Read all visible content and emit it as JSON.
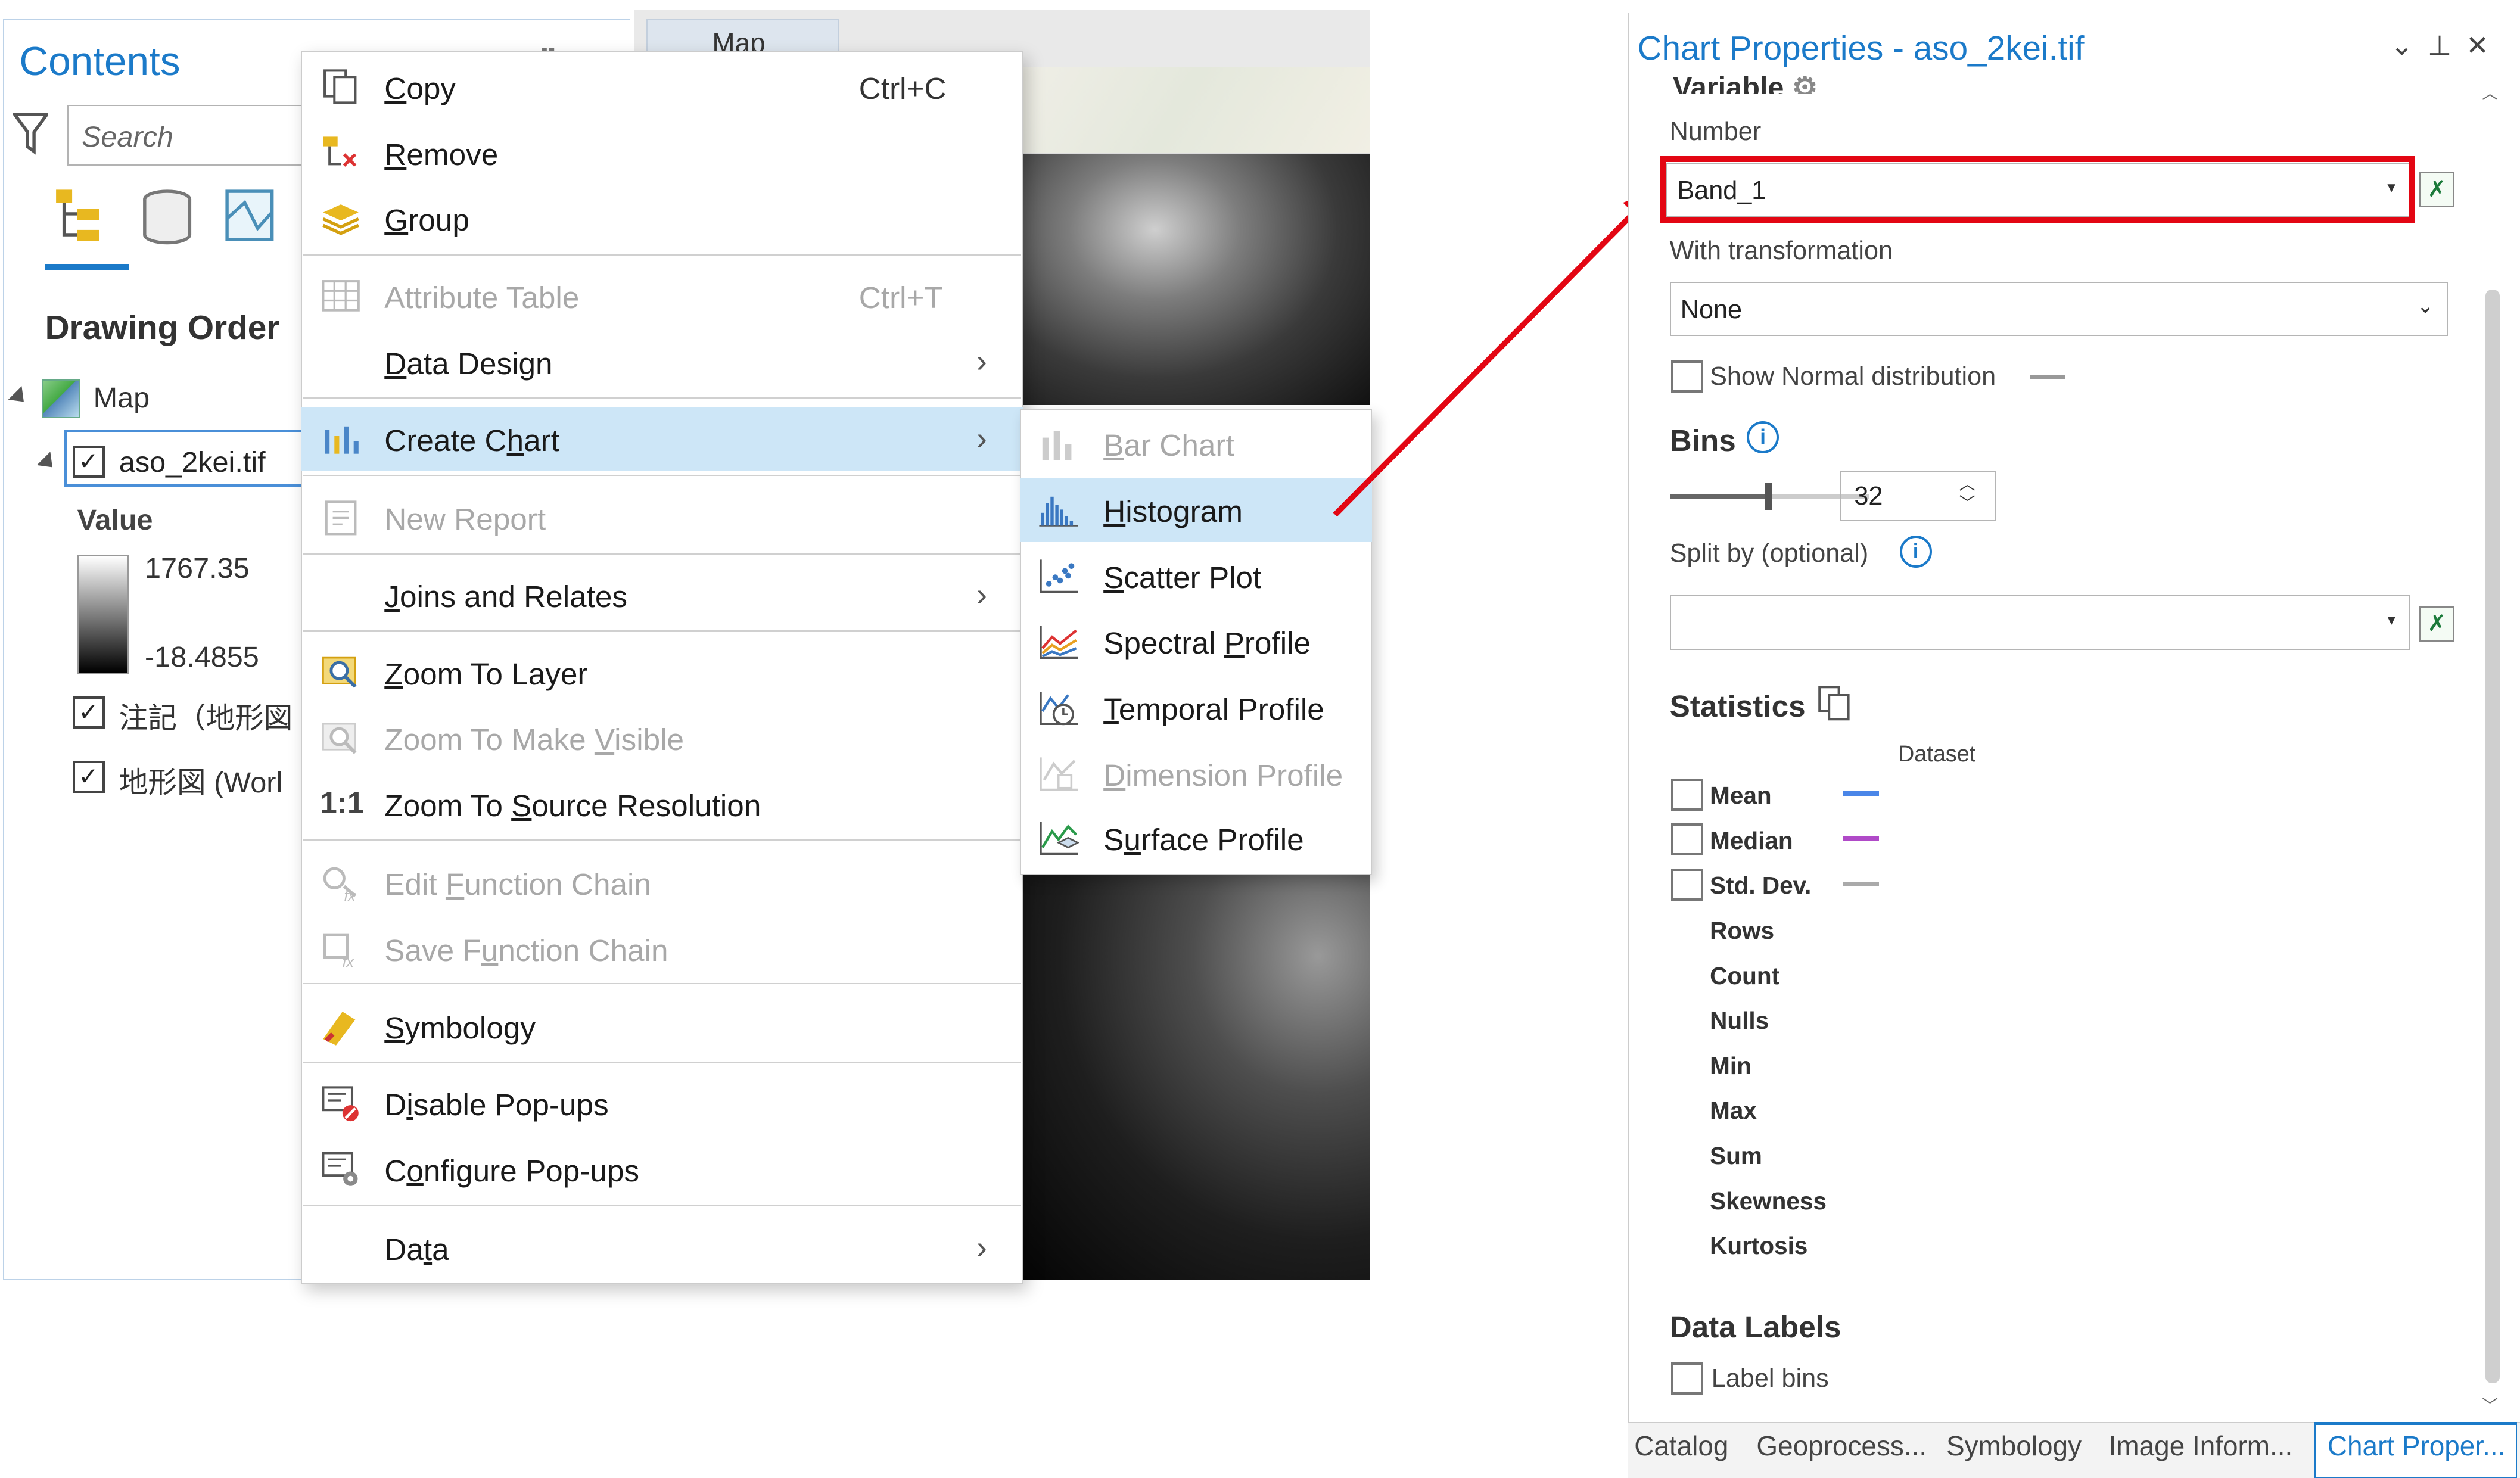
{
  "contents": {
    "title": "Contents",
    "search_placeholder": "Search",
    "drawing_order": "Drawing Order",
    "map_label": "Map",
    "layer_name": "aso_2kei.tif",
    "value_label": "Value",
    "legend_max": "1767.35",
    "legend_min": "-18.4855",
    "layer2_name": "注記（地形図",
    "layer3_name": "地形図 (Worl"
  },
  "map_tab": {
    "label": "Map"
  },
  "context_menu": {
    "copy": {
      "pre": "",
      "key": "C",
      "post": "opy",
      "shortcut": "Ctrl+C"
    },
    "remove": {
      "pre": "",
      "key": "R",
      "post": "emove"
    },
    "group": {
      "pre": "",
      "key": "G",
      "post": "roup"
    },
    "attribute_table": {
      "label": "Attribute Table",
      "shortcut": "Ctrl+T"
    },
    "data_design": {
      "pre": "",
      "key": "D",
      "post": "ata Design"
    },
    "create_chart": {
      "pre": "Create C",
      "key": "h",
      "post": "art"
    },
    "new_report": {
      "label": "New Report"
    },
    "joins": {
      "pre": "",
      "key": "J",
      "post": "oins and Relates"
    },
    "zoom_layer": {
      "pre": "",
      "key": "Z",
      "post": "oom To Layer"
    },
    "zoom_visible": {
      "pre": "Zoom To Make ",
      "key": "V",
      "post": "isible"
    },
    "zoom_source": {
      "pre": "Zoom To ",
      "key": "S",
      "post": "ource Resolution"
    },
    "edit_function": {
      "pre": "Edit ",
      "key": "F",
      "post": "unction Chain"
    },
    "save_function": {
      "pre": "Save F",
      "key": "u",
      "post": "nction Chain"
    },
    "symbology": {
      "pre": "",
      "key": "S",
      "post": "ymbology"
    },
    "disable_popups": {
      "pre": "D",
      "key": "i",
      "post": "sable Pop-ups"
    },
    "configure_popups": {
      "pre": "C",
      "key": "o",
      "post": "nfigure Pop-ups"
    },
    "data": {
      "pre": "Da",
      "key": "t",
      "post": "a"
    }
  },
  "submenu": {
    "bar_chart": {
      "pre": "",
      "key": "B",
      "post": "ar Chart"
    },
    "histogram": {
      "pre": "",
      "key": "H",
      "post": "istogram"
    },
    "scatter": {
      "pre": "",
      "key": "S",
      "post": "catter Plot"
    },
    "spectral": {
      "pre": "Spectral ",
      "key": "P",
      "post": "rofile"
    },
    "temporal": {
      "pre": "",
      "key": "T",
      "post": "emporal Profile"
    },
    "dimension": {
      "pre": "",
      "key": "D",
      "post": "imension Profile"
    },
    "surface": {
      "pre": "S",
      "key": "u",
      "post": "rface Profile"
    }
  },
  "chart_properties": {
    "title": "Chart Properties - aso_2kei.tif",
    "variable_heading": "Variable",
    "number_label": "Number",
    "number_value": "Band_1",
    "with_transformation": "With transformation",
    "transformation_value": "None",
    "show_normal": "Show Normal distribution",
    "bins_heading": "Bins",
    "bins_value": "32",
    "bins_fraction": 0.5,
    "split_by": "Split by (optional)",
    "statistics_heading": "Statistics",
    "dataset_col": "Dataset",
    "mean": "Mean",
    "median": "Median",
    "std_dev": "Std. Dev.",
    "rows": "Rows",
    "count": "Count",
    "nulls": "Nulls",
    "min": "Min",
    "max": "Max",
    "sum": "Sum",
    "skewness": "Skewness",
    "kurtosis": "Kurtosis",
    "data_labels_heading": "Data Labels",
    "label_bins": "Label bins",
    "mean_color": "#4a86e8",
    "median_color": "#b04ac8",
    "std_color": "#aaaaaa"
  },
  "pane_tabs": {
    "catalog": "Catalog",
    "geoprocessing": "Geoprocess...",
    "symbology": "Symbology",
    "image_info": "Image Inform...",
    "chart_props": "Chart Proper..."
  },
  "colors": {
    "accent": "#1b7ac9",
    "highlight": "#cde6f7",
    "annotation_red": "#e30613"
  }
}
